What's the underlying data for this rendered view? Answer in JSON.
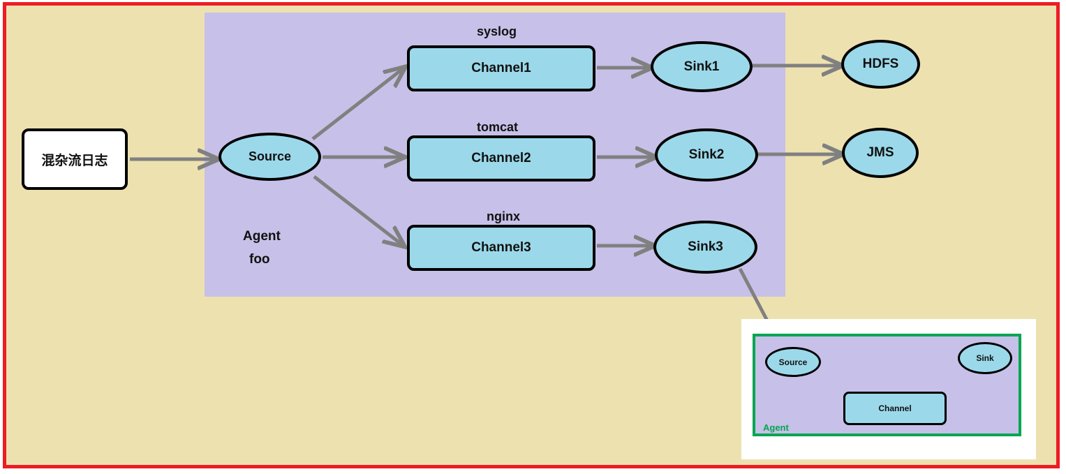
{
  "title": "Flume multi-channel agent flow diagram",
  "colors": {
    "background_beige": "#EDE1B0",
    "outer_border_red": "#ED1C24",
    "agent_fill_lavender": "#C7C0E8",
    "agent_border_purple": "#A93CA9",
    "node_fill_blue": "#9BD9EA",
    "node_border_black": "#000000",
    "arrow_gray": "#808080",
    "inset_agent_green": "#00A651",
    "source_box_white": "#FFFFFF"
  },
  "main": {
    "input_node": {
      "label": "混杂流日志",
      "shape": "rounded-rect"
    },
    "agent": {
      "label_line1": "Agent",
      "label_line2": "foo",
      "source": {
        "label": "Source",
        "shape": "ellipse"
      },
      "branches": [
        {
          "protocol_label": "syslog",
          "channel": {
            "label": "Channel1",
            "shape": "rounded-rect"
          },
          "sink": {
            "label": "Sink1",
            "shape": "ellipse"
          }
        },
        {
          "protocol_label": "tomcat",
          "channel": {
            "label": "Channel2",
            "shape": "rounded-rect"
          },
          "sink": {
            "label": "Sink2",
            "shape": "ellipse"
          }
        },
        {
          "protocol_label": "nginx",
          "channel": {
            "label": "Channel3",
            "shape": "rounded-rect"
          },
          "sink": {
            "label": "Sink3",
            "shape": "ellipse"
          }
        }
      ]
    },
    "destinations": [
      {
        "label": "HDFS",
        "shape": "ellipse"
      },
      {
        "label": "JMS",
        "shape": "ellipse"
      }
    ]
  },
  "inset": {
    "agent_label": "Agent",
    "source": {
      "label": "Source",
      "shape": "ellipse"
    },
    "channel": {
      "label": "Channel",
      "shape": "rounded-rect"
    },
    "sink": {
      "label": "Sink",
      "shape": "ellipse"
    }
  }
}
